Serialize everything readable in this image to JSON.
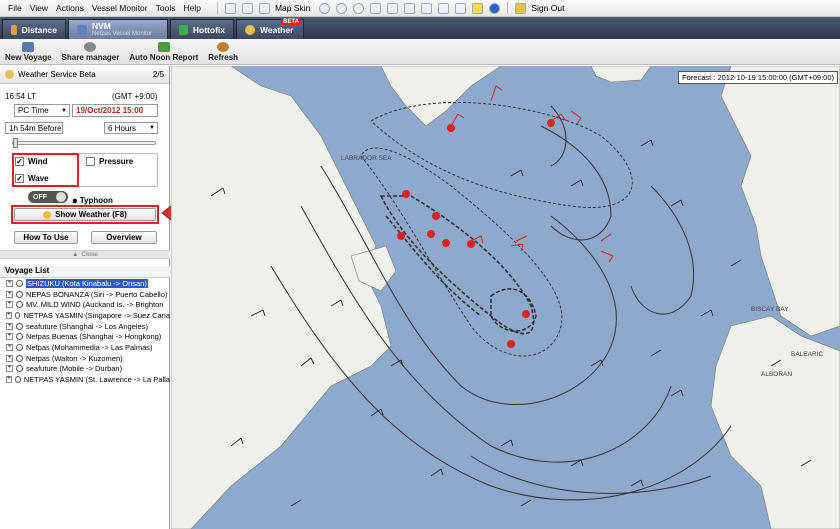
{
  "menu": [
    "File",
    "View",
    "Actions",
    "Vessel Monitor",
    "Tools",
    "Help"
  ],
  "menu_extra": {
    "map_skin": "Map Skin",
    "sign_out": "Sign Out"
  },
  "tabs": [
    {
      "label": "Distance",
      "sub": "",
      "color": "#d8a040"
    },
    {
      "label": "NVM",
      "sub": "Netpas Vessel Monitor",
      "color": "#6080c0"
    },
    {
      "label": "Hottofix",
      "sub": "",
      "color": "#40b040"
    },
    {
      "label": "Weather",
      "sub": "",
      "color": "#e0c050",
      "badge": "BETA"
    }
  ],
  "toolbar": [
    "New Voyage",
    "Share manager",
    "Auto Noon Report",
    "Refresh"
  ],
  "panel": {
    "title": "Weather Service Beta",
    "page": "2/5",
    "time_lt": "16:54 LT",
    "gmt": "(GMT +9:00)",
    "time_mode": "PC Time",
    "date": "19/Oct/2012 15:00",
    "before": "1h 54m Before",
    "interval": "6 Hours",
    "wind": "Wind",
    "pressure": "Pressure",
    "wave": "Wave",
    "off": "OFF",
    "typhoon": "Typhoon",
    "show_weather": "Show Weather (F8)",
    "how_to_use": "How To Use",
    "overview": "Overview",
    "close": "Close"
  },
  "voyage_list": {
    "title": "Voyage List",
    "items": [
      "SHIZUKU (Kota Kinabalu -> Onsan)",
      "NEPAS BONANZA (Siri -> Puerto Cabello)",
      "MV. MILD WIND (Auckand Is. -> Brighton",
      "NETPAS YASMIN (Singapore -> Suez Cana",
      "seafuture (Shanghai -> Los Angeles)",
      "Netpas Buenas (Shanghai -> Hongkong)",
      "Netpas (Mohammedia -> Las Palmas)",
      "Netpas (Walton -> Kuzomen)",
      "seafuture (Mobile -> Durban)",
      "NETPAS YASMIN (St. Lawrence -> La Palla"
    ]
  },
  "map": {
    "forecast": "Forecast : 2012-10-19 15:00:00 (GMT+09:00)",
    "labels": [
      "LABRADOR SEA",
      "BISCAY BAY",
      "BALEARIC",
      "ALBORAN"
    ]
  },
  "colors": {
    "red": "#e02020",
    "sea": "#8ea9cc",
    "land": "#eef0ea"
  }
}
